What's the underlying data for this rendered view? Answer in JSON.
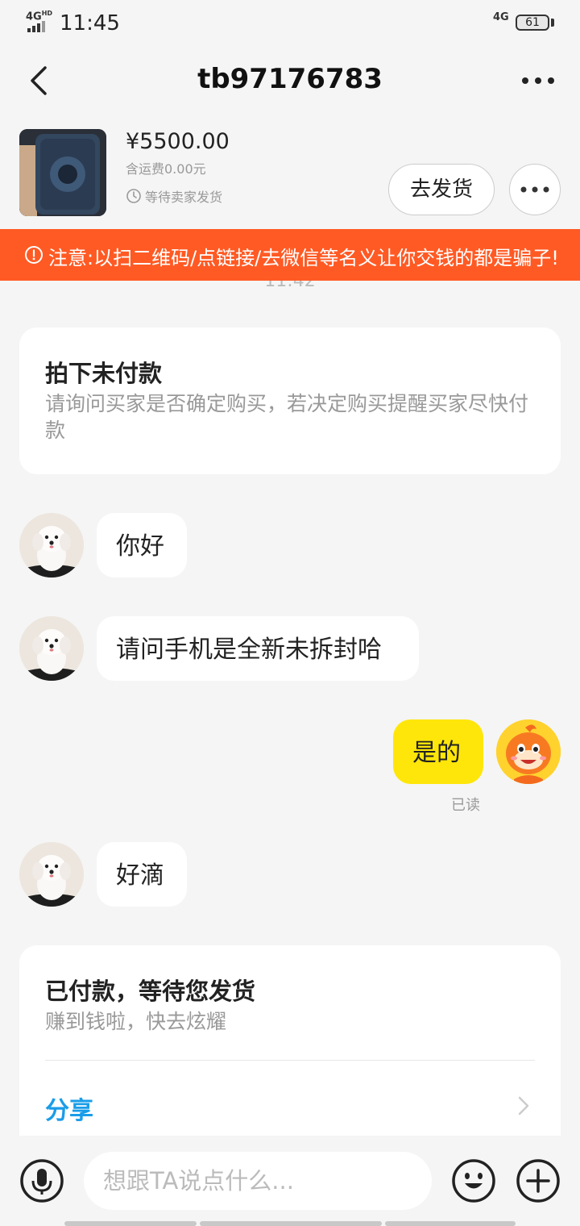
{
  "status_bar": {
    "network_left": "4G",
    "network_hd": "HD",
    "time": "11:45",
    "network_right": "4G",
    "battery": "61"
  },
  "header": {
    "title": "tb97176783",
    "back_icon": "chevron-left-icon",
    "more_icon": "more-dots-icon"
  },
  "product": {
    "price": "¥5500.00",
    "shipping": "含运费0.00元",
    "status": "等待卖家发货",
    "status_icon": "clock-icon",
    "ship_button": "去发货"
  },
  "warning": {
    "text": "注意:以扫二维码/点链接/去微信等名义让你交钱的都是骗子!",
    "color": "#ff5a24"
  },
  "chat": {
    "timestamp": "11:42",
    "system_card_1": {
      "title": "拍下未付款",
      "description": "请询问买家是否确定购买，若决定购买提醒买家尽快付款"
    },
    "messages": [
      {
        "from": "buyer",
        "text": "你好"
      },
      {
        "from": "buyer",
        "text": "请问手机是全新未拆封哈"
      },
      {
        "from": "me",
        "text": "是的",
        "status": "已读"
      },
      {
        "from": "buyer",
        "text": "好滴"
      }
    ],
    "system_card_2": {
      "title": "已付款，等待您发货",
      "description": "赚到钱啦，快去炫耀",
      "action": "分享"
    }
  },
  "input_bar": {
    "placeholder": "想跟TA说点什么...",
    "voice_icon": "microphone-icon",
    "emoji_icon": "emoji-icon",
    "plus_icon": "plus-icon"
  },
  "colors": {
    "my_bubble": "#ffe60a",
    "link": "#1a9de8",
    "background": "#f5f5f5"
  }
}
